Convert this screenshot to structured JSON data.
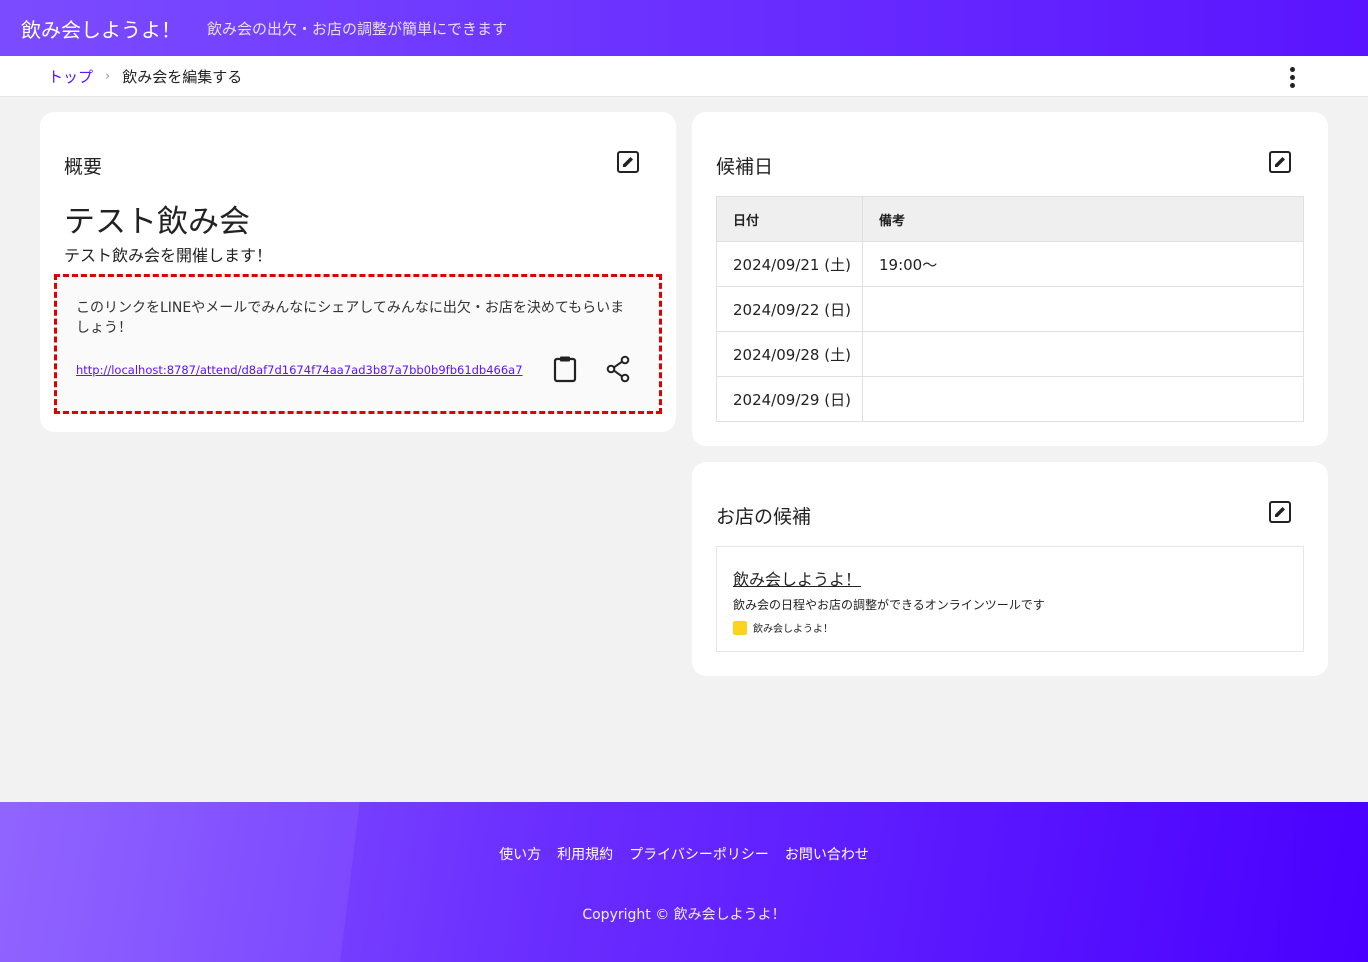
{
  "header": {
    "title": "飲み会しようよ！",
    "tagline": "飲み会の出欠・お店の調整が簡単にできます"
  },
  "breadcrumb": {
    "home": "トップ",
    "separator": "›",
    "current": "飲み会を編集する"
  },
  "summary": {
    "title": "概要",
    "event_name": "テスト飲み会",
    "event_description": "テスト飲み会を開催します！",
    "share_message": "このリンクをLINEやメールでみんなにシェアしてみんなに出欠・お店を決めてもらいましょう！",
    "share_url": "http://localhost:8787/attend/d8af7d1674f74aa7ad3b87a7bb0b9fb61db466a7",
    "copy_icon": "clipboard-icon",
    "share_icon": "share-icon"
  },
  "dates": {
    "title": "候補日",
    "columns": [
      "日付",
      "備考"
    ],
    "rows": [
      {
        "date": "2024/09/21 (土)",
        "note": "19:00～"
      },
      {
        "date": "2024/09/22 (日)",
        "note": ""
      },
      {
        "date": "2024/09/28 (土)",
        "note": ""
      },
      {
        "date": "2024/09/29 (日)",
        "note": ""
      }
    ]
  },
  "shops": {
    "title": "お店の候補",
    "items": [
      {
        "title": "飲み会しようよ！",
        "description": "飲み会の日程やお店の調整ができるオンラインツールです",
        "site_name": "飲み会しようよ！"
      }
    ]
  },
  "footer": {
    "links": [
      "使い方",
      "利用規約",
      "プライバシーポリシー",
      "お問い合わせ"
    ],
    "copyright": "Copyright © 飲み会しようよ！"
  },
  "colors": {
    "brand": "#5a14ff",
    "share_box_border": "#e00000"
  }
}
